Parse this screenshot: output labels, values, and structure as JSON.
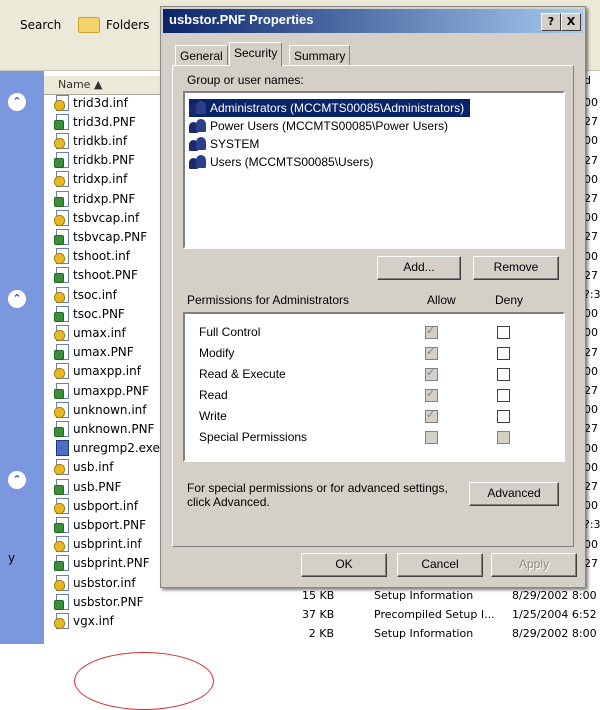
{
  "explorer": {
    "toolbar": {
      "search_label": "Search",
      "folders_label": "Folders"
    },
    "name_header": "Name",
    "files": [
      {
        "name": "trid3d.inf",
        "type": "inf",
        "right": "00"
      },
      {
        "name": "trid3d.PNF",
        "type": "pnf",
        "right": "27"
      },
      {
        "name": "tridkb.inf",
        "type": "inf",
        "right": "00"
      },
      {
        "name": "tridkb.PNF",
        "type": "pnf",
        "right": "27"
      },
      {
        "name": "tridxp.inf",
        "type": "inf",
        "right": "00"
      },
      {
        "name": "tridxp.PNF",
        "type": "pnf",
        "right": "27"
      },
      {
        "name": "tsbvcap.inf",
        "type": "inf",
        "right": "00"
      },
      {
        "name": "tsbvcap.PNF",
        "type": "pnf",
        "right": "27"
      },
      {
        "name": "tshoot.inf",
        "type": "inf",
        "right": "00"
      },
      {
        "name": "tshoot.PNF",
        "type": "pnf",
        "right": "27"
      },
      {
        "name": "tsoc.inf",
        "type": "inf",
        "right": "?:3"
      },
      {
        "name": "tsoc.PNF",
        "type": "pnf",
        "right": "00"
      },
      {
        "name": "umax.inf",
        "type": "inf",
        "right": "00"
      },
      {
        "name": "umax.PNF",
        "type": "pnf",
        "right": "27"
      },
      {
        "name": "umaxpp.inf",
        "type": "inf",
        "right": "00"
      },
      {
        "name": "umaxpp.PNF",
        "type": "pnf",
        "right": "27"
      },
      {
        "name": "unknown.inf",
        "type": "inf",
        "right": "00"
      },
      {
        "name": "unknown.PNF",
        "type": "pnf",
        "right": "27"
      },
      {
        "name": "unregmp2.exe",
        "type": "exe",
        "right": "00"
      },
      {
        "name": "usb.inf",
        "type": "inf",
        "right": "00"
      },
      {
        "name": "usb.PNF",
        "type": "pnf",
        "right": "27"
      },
      {
        "name": "usbport.inf",
        "type": "inf",
        "right": "00"
      },
      {
        "name": "usbport.PNF",
        "type": "pnf",
        "right": "?:3"
      },
      {
        "name": "usbprint.inf",
        "type": "inf",
        "right": "00"
      },
      {
        "name": "usbprint.PNF",
        "type": "pnf",
        "right": "27"
      },
      {
        "name": "usbstor.inf",
        "type": "inf",
        "right": ""
      },
      {
        "name": "usbstor.PNF",
        "type": "pnf",
        "right": ""
      },
      {
        "name": "vgx.inf",
        "type": "inf",
        "right": ""
      }
    ],
    "detail_rows": [
      {
        "size": "15 KB",
        "type": "Setup Information",
        "date": "8/29/2002 8:00"
      },
      {
        "size": "37 KB",
        "type": "Precompiled Setup I...",
        "date": "1/25/2004 6:52"
      },
      {
        "size": "2 KB",
        "type": "Setup Information",
        "date": "8/29/2002 8:00"
      }
    ],
    "left_pane_char": "y",
    "right_header_char": "d"
  },
  "dialog": {
    "title": "usbstor.PNF Properties",
    "help_glyph": "?",
    "close_glyph": "X",
    "tabs": [
      "General",
      "Security",
      "Summary"
    ],
    "active_tab": "Security",
    "group_label": "Group or user names:",
    "users": [
      "Administrators (MCCMTS00085\\Administrators)",
      "Power Users (MCCMTS00085\\Power Users)",
      "SYSTEM",
      "Users (MCCMTS00085\\Users)"
    ],
    "selected_user": "Administrators (MCCMTS00085\\Administrators)",
    "add_label": "Add...",
    "remove_label": "Remove",
    "perm_label": "Permissions for Administrators",
    "allow_label": "Allow",
    "deny_label": "Deny",
    "permissions": [
      {
        "name": "Full Control",
        "allow": "checked-disabled",
        "deny": "empty"
      },
      {
        "name": "Modify",
        "allow": "checked-disabled",
        "deny": "empty"
      },
      {
        "name": "Read & Execute",
        "allow": "checked-disabled",
        "deny": "empty"
      },
      {
        "name": "Read",
        "allow": "checked-disabled",
        "deny": "empty"
      },
      {
        "name": "Write",
        "allow": "checked-disabled",
        "deny": "empty"
      },
      {
        "name": "Special Permissions",
        "allow": "empty-disabled",
        "deny": "empty-disabled"
      }
    ],
    "advanced_text_line1": "For special permissions or for advanced settings,",
    "advanced_text_line2": "click Advanced.",
    "advanced_label": "Advanced",
    "ok_label": "OK",
    "cancel_label": "Cancel",
    "apply_label": "Apply"
  },
  "colors": {
    "titlebar": "#0A246A",
    "dialog_bg": "#D4D0C8",
    "selection": "#0A246A",
    "highlight_circle": "#d23030"
  }
}
